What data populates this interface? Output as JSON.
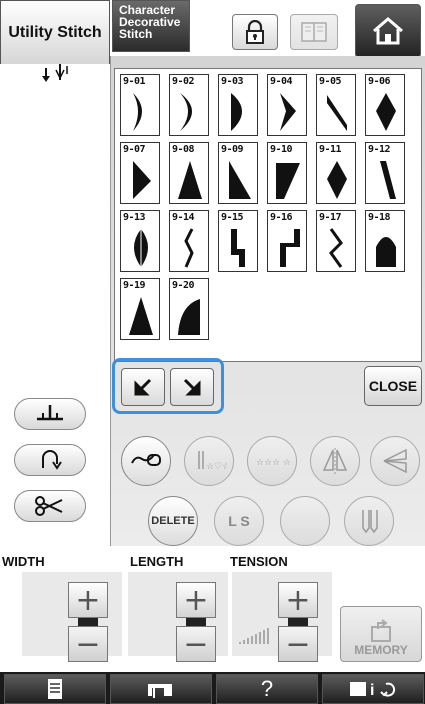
{
  "tabs": {
    "utility": "Utility Stitch",
    "character_line1": "Character",
    "character_line2": "Decorative",
    "character_line3": "Stitch"
  },
  "stitches": [
    {
      "id": "9-01",
      "shape": "crescent"
    },
    {
      "id": "9-02",
      "shape": "crescent-wide"
    },
    {
      "id": "9-03",
      "shape": "half-round"
    },
    {
      "id": "9-04",
      "shape": "chevron"
    },
    {
      "id": "9-05",
      "shape": "slant"
    },
    {
      "id": "9-06",
      "shape": "diamond"
    },
    {
      "id": "9-07",
      "shape": "arrow-right"
    },
    {
      "id": "9-08",
      "shape": "triangle"
    },
    {
      "id": "9-09",
      "shape": "right-triangle"
    },
    {
      "id": "9-10",
      "shape": "wedge"
    },
    {
      "id": "9-11",
      "shape": "diamond"
    },
    {
      "id": "9-12",
      "shape": "bar-slant"
    },
    {
      "id": "9-13",
      "shape": "leaf"
    },
    {
      "id": "9-14",
      "shape": "zigzag-thin"
    },
    {
      "id": "9-15",
      "shape": "step"
    },
    {
      "id": "9-16",
      "shape": "step-reverse"
    },
    {
      "id": "9-17",
      "shape": "zigzag"
    },
    {
      "id": "9-18",
      "shape": "dome"
    },
    {
      "id": "9-19",
      "shape": "cone"
    },
    {
      "id": "9-20",
      "shape": "quarter"
    }
  ],
  "buttons": {
    "close": "CLOSE",
    "delete": "DELETE",
    "ls": "L S",
    "memory": "MEMORY",
    "help": "?"
  },
  "controls": {
    "width": "WIDTH",
    "length": "LENGTH",
    "tension": "TENSION"
  },
  "colors": {
    "highlight": "#3d8fe0",
    "dark_button": "#2b2b2b"
  }
}
